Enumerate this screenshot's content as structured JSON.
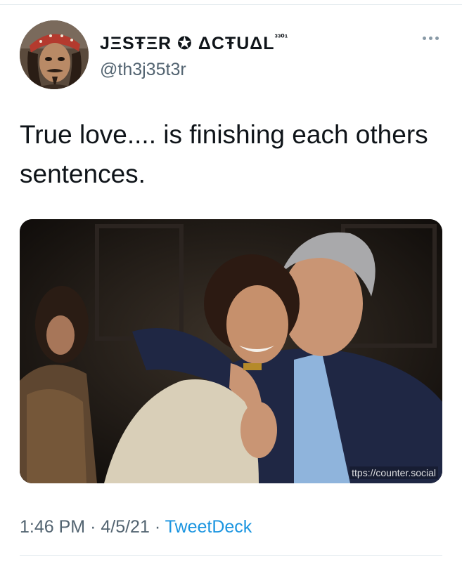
{
  "tweet": {
    "author": {
      "display_name": "JΞSŦΞR ✪ ΔCŦUΔL",
      "display_name_suffix": "³³⁰¹",
      "handle": "@th3j35t3r",
      "avatar_icon": "pirate-avatar"
    },
    "more_icon": "more-dots-icon",
    "text": "True love.... is finishing each others sentences.",
    "media": {
      "watermark": "ttps://counter.social"
    },
    "time": "1:46 PM",
    "separator": "·",
    "date": "4/5/21",
    "source": "TweetDeck"
  },
  "colors": {
    "text": "#0f1419",
    "secondary": "#536471",
    "link": "#1b95e0",
    "divider": "#e6ecf0"
  }
}
